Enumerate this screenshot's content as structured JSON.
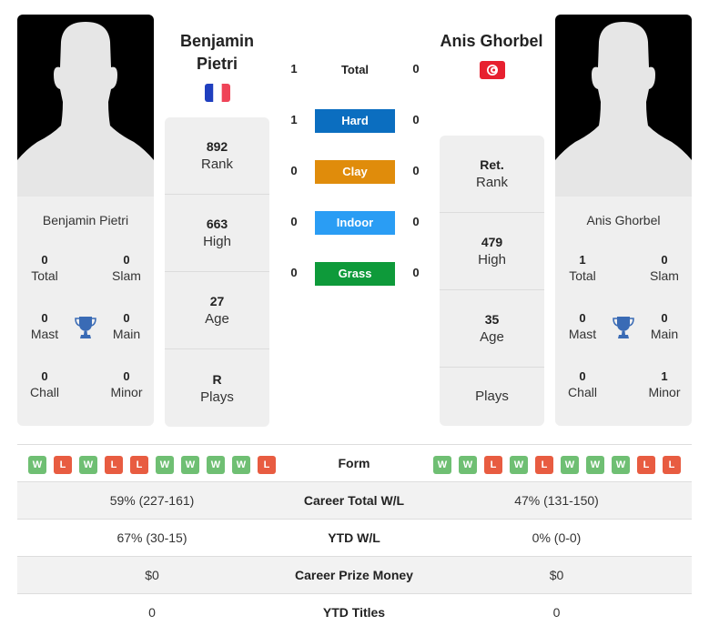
{
  "colors": {
    "hard": "#0b6ec0",
    "clay": "#e08c0b",
    "indoor": "#2a9df4",
    "grass": "#0e9a3a",
    "win": "#6fbf73",
    "loss": "#e85c41",
    "trophy": "#3a6bb5"
  },
  "player1": {
    "name": "Benjamin Pietri",
    "name_line1": "Benjamin",
    "name_line2": "Pietri",
    "flag": "france-flag-icon",
    "titles": {
      "total": {
        "value": "0",
        "label": "Total"
      },
      "slam": {
        "value": "0",
        "label": "Slam"
      },
      "mast": {
        "value": "0",
        "label": "Mast"
      },
      "main": {
        "value": "0",
        "label": "Main"
      },
      "chall": {
        "value": "0",
        "label": "Chall"
      },
      "minor": {
        "value": "0",
        "label": "Minor"
      }
    },
    "stats": [
      {
        "value": "892",
        "label": "Rank"
      },
      {
        "value": "663",
        "label": "High"
      },
      {
        "value": "27",
        "label": "Age"
      },
      {
        "value": "R",
        "label": "Plays"
      }
    ],
    "form": [
      "W",
      "L",
      "W",
      "L",
      "L",
      "W",
      "W",
      "W",
      "W",
      "L"
    ]
  },
  "player2": {
    "name": "Anis Ghorbel",
    "flag": "tunisia-flag-icon",
    "titles": {
      "total": {
        "value": "1",
        "label": "Total"
      },
      "slam": {
        "value": "0",
        "label": "Slam"
      },
      "mast": {
        "value": "0",
        "label": "Mast"
      },
      "main": {
        "value": "0",
        "label": "Main"
      },
      "chall": {
        "value": "0",
        "label": "Chall"
      },
      "minor": {
        "value": "1",
        "label": "Minor"
      }
    },
    "stats": [
      {
        "value": "Ret.",
        "label": "Rank"
      },
      {
        "value": "479",
        "label": "High"
      },
      {
        "value": "35",
        "label": "Age"
      },
      {
        "value": "",
        "label": "Plays"
      }
    ],
    "form": [
      "W",
      "W",
      "L",
      "W",
      "L",
      "W",
      "W",
      "W",
      "L",
      "L"
    ]
  },
  "h2h": [
    {
      "label": "Total",
      "p1": "1",
      "p2": "0",
      "surface": "total"
    },
    {
      "label": "Hard",
      "p1": "1",
      "p2": "0",
      "surface": "hard"
    },
    {
      "label": "Clay",
      "p1": "0",
      "p2": "0",
      "surface": "clay"
    },
    {
      "label": "Indoor",
      "p1": "0",
      "p2": "0",
      "surface": "indoor"
    },
    {
      "label": "Grass",
      "p1": "0",
      "p2": "0",
      "surface": "grass"
    }
  ],
  "comparison": [
    {
      "label": "Form",
      "p1": "",
      "p2": ""
    },
    {
      "label": "Career Total W/L",
      "p1": "59% (227-161)",
      "p2": "47% (131-150)"
    },
    {
      "label": "YTD W/L",
      "p1": "67% (30-15)",
      "p2": "0% (0-0)"
    },
    {
      "label": "Career Prize Money",
      "p1": "$0",
      "p2": "$0"
    },
    {
      "label": "YTD Titles",
      "p1": "0",
      "p2": "0"
    }
  ]
}
